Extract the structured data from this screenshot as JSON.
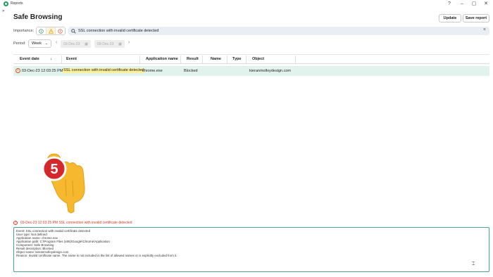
{
  "window": {
    "title": "Reports",
    "help": "?",
    "minimize": "–",
    "maximize": "▢",
    "close": "✕"
  },
  "sidebar": {
    "collapse_glyph": "»"
  },
  "page": {
    "title": "Safe Browsing",
    "update_button": "Update",
    "save_button": "Save report"
  },
  "filters": {
    "importance_label": "Importance:",
    "search_value": "SSL connection with invalid certificate detected",
    "period_label": "Period:",
    "period_value": "Week",
    "date_from": "03-Dec-23",
    "date_to": "09-Dec-23"
  },
  "table": {
    "columns": [
      "Event date",
      "Event",
      "Application name",
      "Result",
      "Name",
      "Type",
      "Object"
    ],
    "sort_indicator": "↓",
    "rows": [
      {
        "event_date": "03-Dec-23 12:03:25 PM",
        "event": "SSL connection with invalid certificate detected",
        "application": "chrome.exe",
        "result": "Blocked",
        "name": "",
        "type": "",
        "object": "kieranmolloydesign.com"
      }
    ]
  },
  "overlay": {
    "step_number": "5",
    "step_color": "#d4282a",
    "hand_color": "#f5b82e"
  },
  "details": {
    "header": "03-Dec-23 12:03:25 PM SSL connection with invalid certificate detected",
    "lines": [
      "Event: SSL connection with invalid certificate detected",
      "User type: Not defined",
      "Application name: chrome.exe",
      "Application path: C:\\Program Files (x86)\\Google\\Chrome\\Application",
      "Component: Safe Browsing",
      "Result description: Blocked",
      "Object name: kieranmolloydesign.com",
      "Reason: Invalid certificate name. The name is not included in the list of allowed names or is explicitly excluded from it."
    ],
    "cursor_glyph": "⌶"
  },
  "colors": {
    "accent_green": "#1e9a5a",
    "row_highlight": "#e2f3ee",
    "text_highlight": "#fff09a",
    "warning_red": "#d23c2a",
    "detail_border": "#4aa68a"
  }
}
